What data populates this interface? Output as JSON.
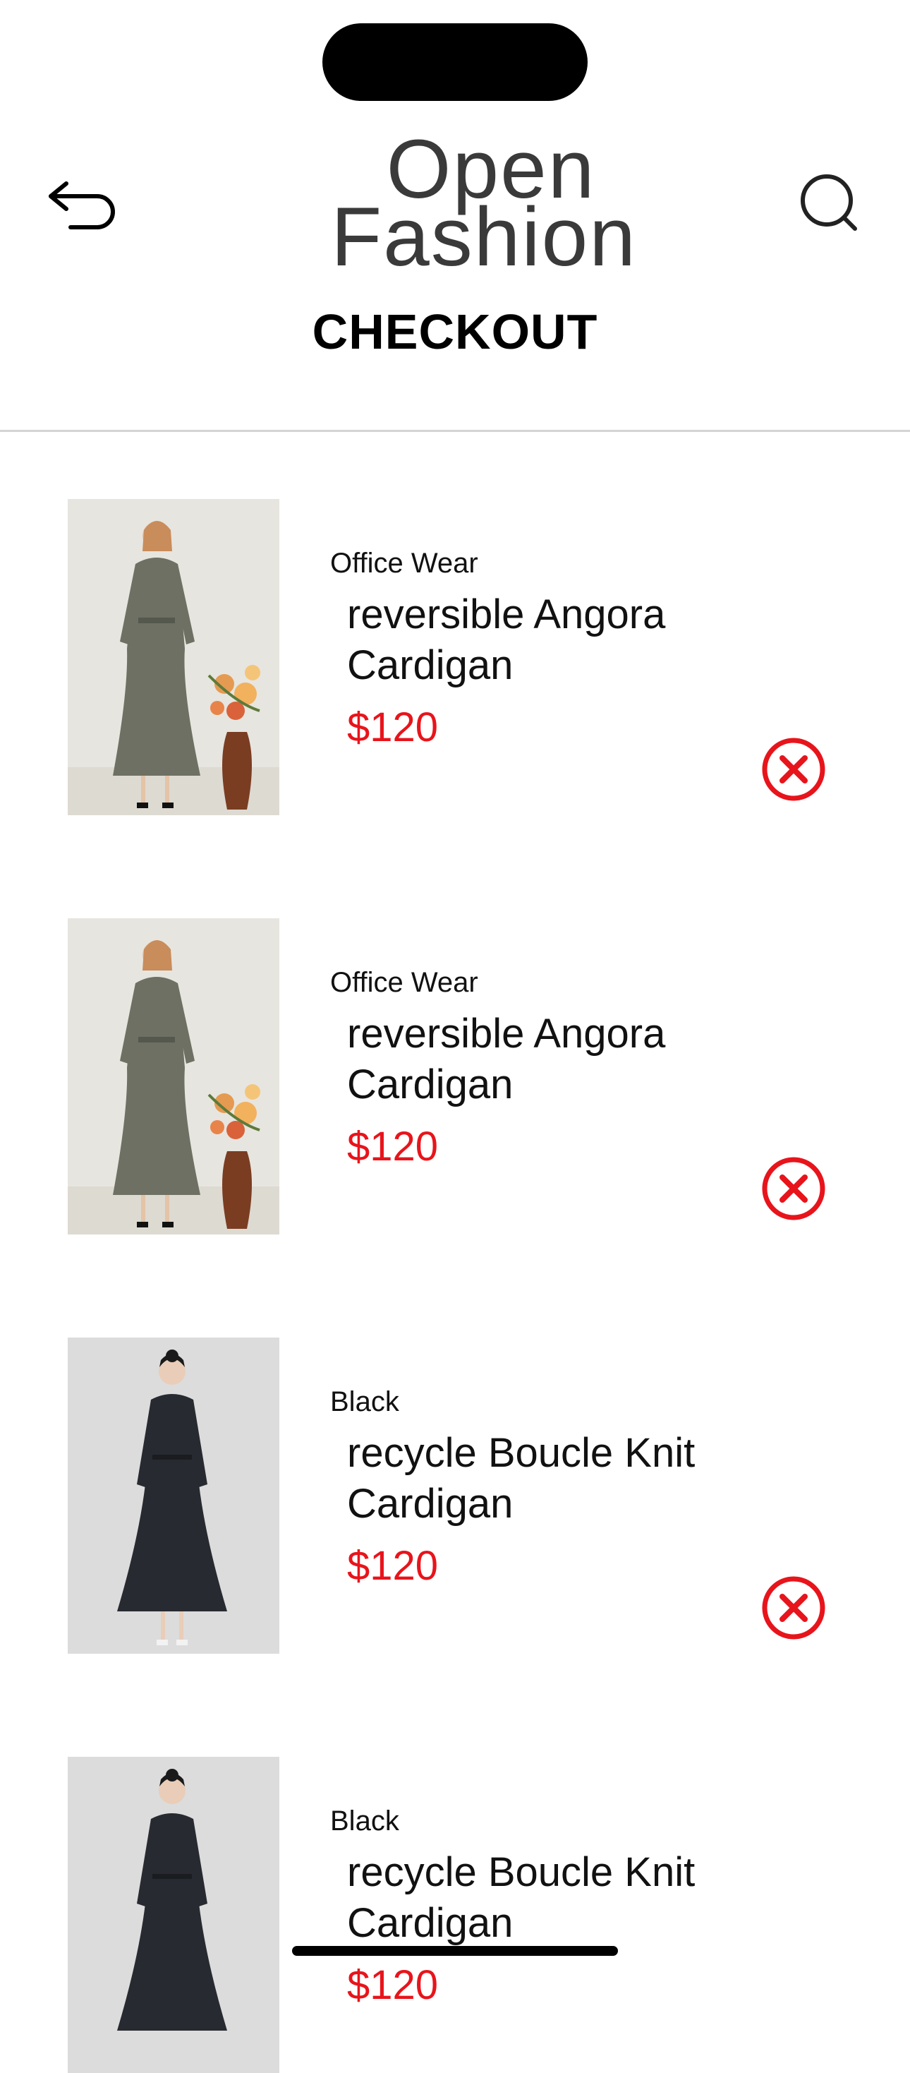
{
  "header": {
    "logo_line1": "Open",
    "logo_line2": "Fashion",
    "title": "CHECKOUT",
    "back_icon": "back-arrow-icon",
    "search_icon": "search-icon"
  },
  "items": [
    {
      "category": "Office Wear",
      "name": "reversible Angora Cardigan",
      "price": "$120",
      "image": "grey-dress-with-flowers",
      "remove_icon": "remove-circle-x-icon"
    },
    {
      "category": "Office Wear",
      "name": "reversible Angora Cardigan",
      "price": "$120",
      "image": "grey-dress-with-flowers",
      "remove_icon": "remove-circle-x-icon"
    },
    {
      "category": "Black",
      "name": "recycle Boucle Knit Cardigan",
      "price": "$120",
      "image": "black-knit-dress",
      "remove_icon": "remove-circle-x-icon"
    },
    {
      "category": "Black",
      "name": "recycle Boucle Knit Cardigan",
      "price": "$120",
      "image": "black-knit-dress",
      "remove_icon": "remove-circle-x-icon"
    }
  ],
  "colors": {
    "price": "#e8141b",
    "remove_icon": "#e8141b",
    "divider": "#d4d4d4",
    "text": "#111111"
  }
}
